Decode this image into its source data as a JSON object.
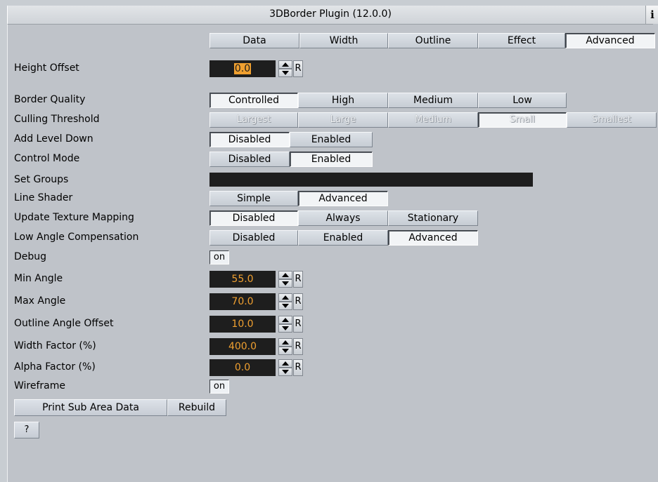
{
  "window": {
    "title": "3DBorder Plugin (12.0.0)",
    "info_label": "i"
  },
  "tabs": [
    "Data",
    "Width",
    "Outline",
    "Effect",
    "Advanced"
  ],
  "selected_tab": "Advanced",
  "height_offset": {
    "label": "Height Offset",
    "value": "0.0",
    "reset": "R"
  },
  "border_quality": {
    "label": "Border Quality",
    "options": [
      "Controlled",
      "High",
      "Medium",
      "Low"
    ],
    "selected": "Controlled"
  },
  "culling_threshold": {
    "label": "Culling Threshold",
    "options": [
      "Largest",
      "Large",
      "Medium",
      "Small",
      "Smallest"
    ],
    "selected": "Small"
  },
  "add_level_down": {
    "label": "Add Level Down",
    "options": [
      "Disabled",
      "Enabled"
    ],
    "selected": "Disabled"
  },
  "control_mode": {
    "label": "Control Mode",
    "options": [
      "Disabled",
      "Enabled"
    ],
    "selected": "Enabled"
  },
  "set_groups": {
    "label": "Set Groups",
    "value": ""
  },
  "line_shader": {
    "label": "Line Shader",
    "options": [
      "Simple",
      "Advanced"
    ],
    "selected": "Advanced"
  },
  "update_texture_mapping": {
    "label": "Update Texture Mapping",
    "options": [
      "Disabled",
      "Always",
      "Stationary"
    ],
    "selected": "Disabled"
  },
  "low_angle_compensation": {
    "label": "Low Angle Compensation",
    "options": [
      "Disabled",
      "Enabled",
      "Advanced"
    ],
    "selected": "Advanced"
  },
  "debug": {
    "label": "Debug",
    "toggle": "on"
  },
  "min_angle": {
    "label": "Min Angle",
    "value": "55.0",
    "reset": "R"
  },
  "max_angle": {
    "label": "Max Angle",
    "value": "70.0",
    "reset": "R"
  },
  "outline_angle_offset": {
    "label": "Outline Angle Offset",
    "value": "10.0",
    "reset": "R"
  },
  "width_factor": {
    "label": "Width Factor (%)",
    "value": "400.0",
    "reset": "R"
  },
  "alpha_factor": {
    "label": "Alpha Factor (%)",
    "value": "0.0",
    "reset": "R"
  },
  "wireframe": {
    "label": "Wireframe",
    "toggle": "on"
  },
  "actions": {
    "print_sub_area": "Print Sub Area Data",
    "rebuild": "Rebuild",
    "help": "?"
  }
}
